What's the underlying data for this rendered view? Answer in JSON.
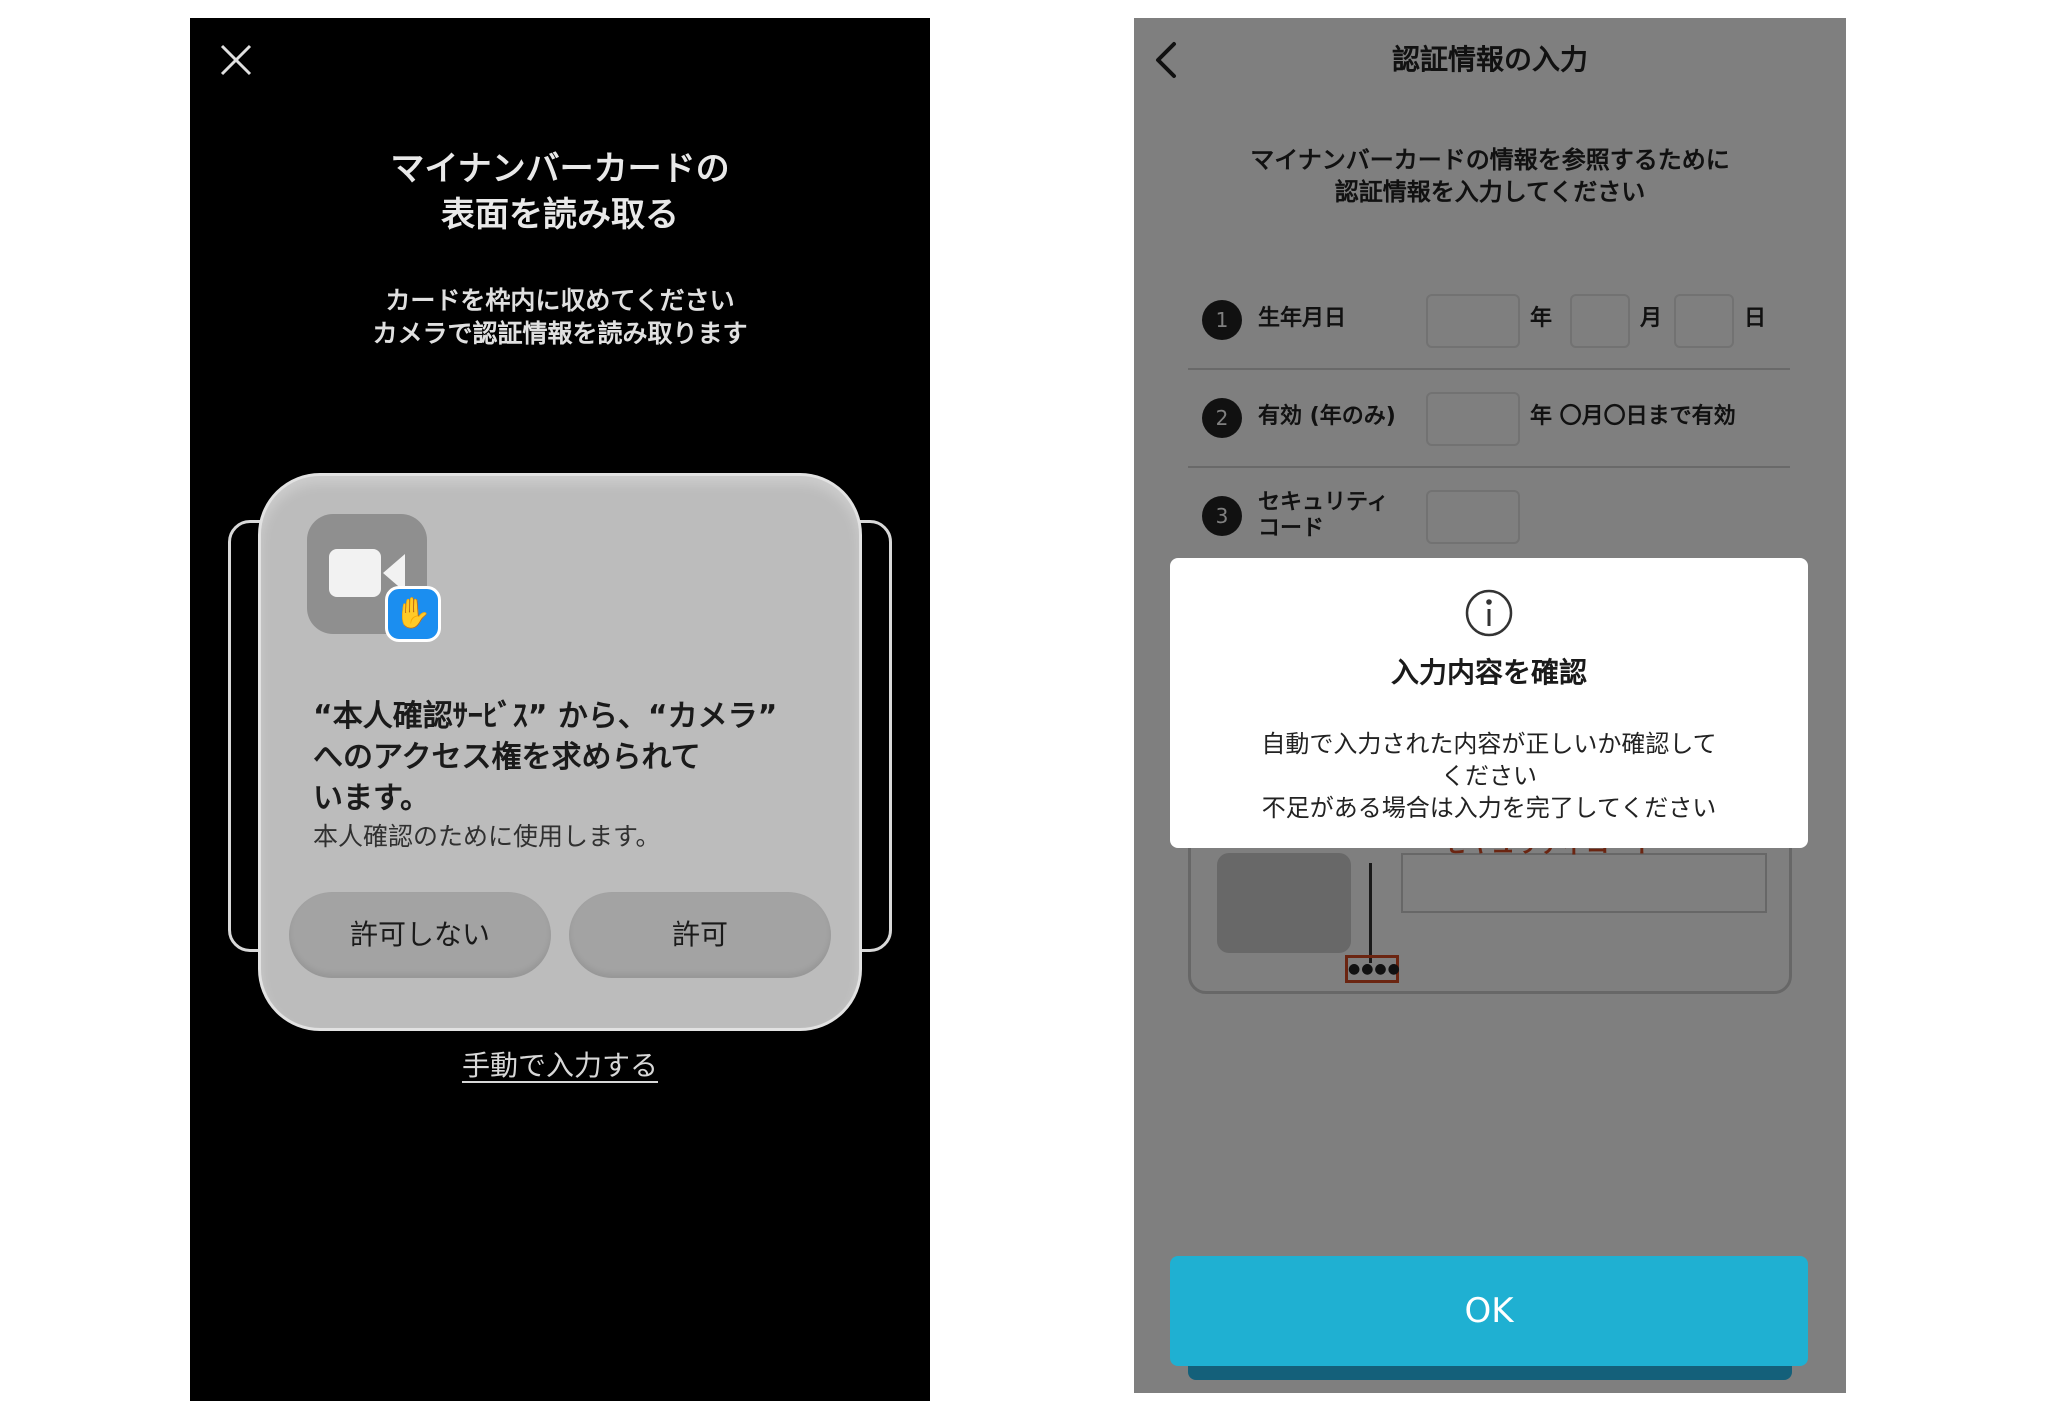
{
  "left_screen": {
    "title_lines": [
      "マイナンバーカードの",
      "表面を読み取る"
    ],
    "subtitle_lines": [
      "カードを枠内に収めてください",
      "カメラで認証情報を読み取ります"
    ],
    "permission_dialog": {
      "title_lines": [
        "“本人確認ｻｰﾋﾞｽ” から、“カメラ”",
        "へのアクセス権を求められて",
        "います。"
      ],
      "description": "本人確認のために使用します。",
      "deny_label": "許可しない",
      "allow_label": "許可",
      "app_icon": "video-camera-icon",
      "badge_icon": "hand-icon",
      "badge_glyph": "✋"
    },
    "manual_link": "手動で入力する",
    "close_icon": "close-icon"
  },
  "right_screen": {
    "nav_title": "認証情報の入力",
    "back_icon": "chevron-left-icon",
    "intro_lines": [
      "マイナンバーカードの情報を参照するために",
      "認証情報を入力してください"
    ],
    "form": {
      "rows": [
        {
          "num": "1",
          "label": "生年月日",
          "units": [
            "年",
            "月",
            "日"
          ]
        },
        {
          "num": "2",
          "label": "有効 (年のみ)",
          "units": [
            "年 〇月〇日まで有効"
          ]
        },
        {
          "num": "3",
          "label_lines": [
            "セキュリティ",
            "コード"
          ]
        }
      ]
    },
    "card_illustration": {
      "code_dots": "●●●●",
      "security_label": "セキュリティコード"
    },
    "modal": {
      "icon": "info-icon",
      "title": "入力内容を確認",
      "body_lines": [
        "自動で入力された内容が正しいか確認して",
        "ください",
        "不足がある場合は入力を完了してください"
      ]
    },
    "ok_label": "OK"
  },
  "colors": {
    "accent": "#1fb0d2",
    "badge_blue": "#1b8ef0",
    "warning_orange": "#d64b22"
  }
}
